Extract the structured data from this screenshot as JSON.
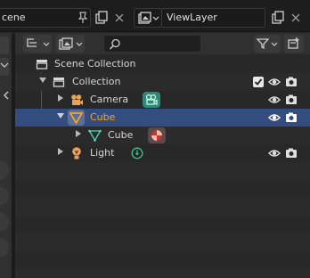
{
  "topbar": {
    "scene_text": "cene",
    "viewlayer_text": "ViewLayer"
  },
  "search": {
    "placeholder": ""
  },
  "outliner": {
    "rows": [
      {
        "label": "Scene Collection",
        "type": "scene"
      },
      {
        "label": "Collection",
        "type": "collection",
        "checked": true
      },
      {
        "label": "Camera",
        "type": "camera"
      },
      {
        "label": "Cube",
        "type": "mesh",
        "selected": true
      },
      {
        "label": "Cube",
        "type": "mesh-data"
      },
      {
        "label": "Light",
        "type": "light"
      }
    ]
  },
  "colors": {
    "selected_row": "#334d80",
    "active_object_text": "#f5a623",
    "camera_data_icon": "#2d8a7a",
    "mesh_data_icon": "#c0392b"
  }
}
